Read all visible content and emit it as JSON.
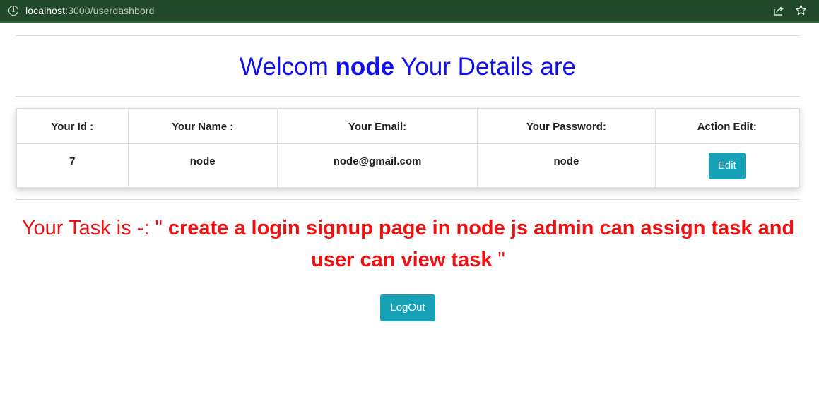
{
  "browser": {
    "url_host": "localhost",
    "url_path": ":3000/userdashbord"
  },
  "heading": {
    "prefix": "Welcom",
    "name": "node",
    "suffix": "Your Details are"
  },
  "table": {
    "headers": [
      "Your Id :",
      "Your Name :",
      "Your Email:",
      "Your Password:",
      "Action Edit:"
    ],
    "row": {
      "id": "7",
      "name": "node",
      "email": "node@gmail.com",
      "password": "node"
    },
    "edit_label": "Edit"
  },
  "task": {
    "prefix": "Your Task is -: \"",
    "text": "create a login signup page in node js admin can assign task and user can view task",
    "suffix": "\""
  },
  "logout_label": "LogOut",
  "colors": {
    "heading": "#1010ee",
    "task": "#ee1111",
    "button": "#17a2b8",
    "address_bar": "#21482a"
  }
}
